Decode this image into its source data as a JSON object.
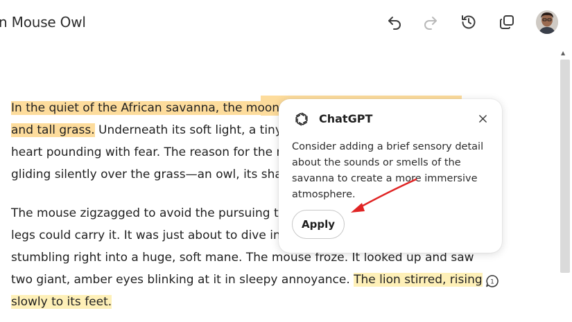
{
  "header": {
    "title": "n Mouse Owl",
    "icons": [
      "undo-icon",
      "redo-icon",
      "history-icon",
      "copy-icon"
    ]
  },
  "document": {
    "paragraph1": {
      "line1": "In the quiet of the African savanna, the moon ca",
      "line2_highlight": "and tall grass.",
      "line2_rest": " Underneath its soft light, a tiny m",
      "line3": "heart pounding with fear. The reason for the mo",
      "line4": "gliding silently over the grass—an owl, its sharp"
    },
    "paragraph2": {
      "line1": "The mouse zigzagged to avoid the pursuing tal",
      "line2": "legs could carry it. It was just about to dive into",
      "line3": "stumbling right into a huge, soft mane. The mouse froze. It looked up and saw",
      "line4_plain": "two giant, amber eyes blinking at it in sleepy annoyance. ",
      "line4_highlight": "The lion stirred, rising",
      "line5_highlight": "slowly to its feet."
    },
    "comment_count": "1"
  },
  "suggestion_popover": {
    "title": "ChatGPT",
    "body": "Consider adding a brief sensory detail about the sounds or smells of the savanna to create a more immersive atmosphere.",
    "apply_label": "Apply"
  },
  "colors": {
    "highlight_selected": "#fddc9c",
    "highlight_comment": "#fef0b8",
    "annotation_arrow": "#e02424"
  }
}
